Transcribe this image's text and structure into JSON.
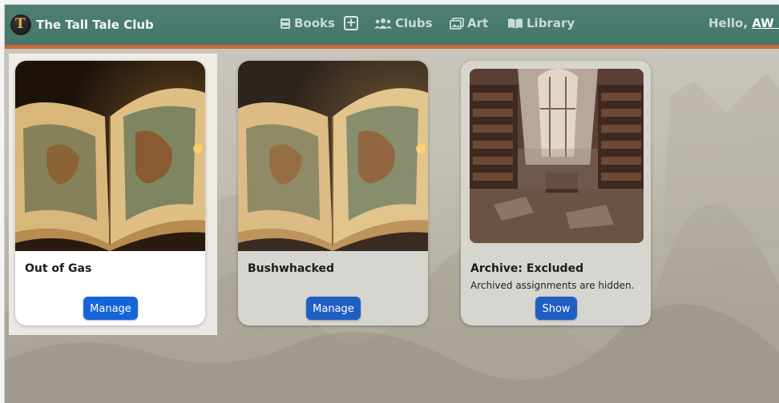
{
  "app": {
    "title": "The Tall Tale Club",
    "logo_letter": "T"
  },
  "nav": {
    "books": "Books",
    "add": "+",
    "clubs": "Clubs",
    "art": "Art",
    "library": "Library",
    "greeting_prefix": "Hello,",
    "user": "AW R"
  },
  "cards": [
    {
      "title": "Out of Gas",
      "button": "Manage",
      "selected": true
    },
    {
      "title": "Bushwhacked",
      "button": "Manage",
      "selected": false
    },
    {
      "title": "Archive: Excluded",
      "description": "Archived assignments are hidden.",
      "button": "Show",
      "selected": false
    }
  ],
  "colors": {
    "nav_bg": "#4a7b6f",
    "nav_border": "#c7663a",
    "button": "#1565d8"
  }
}
